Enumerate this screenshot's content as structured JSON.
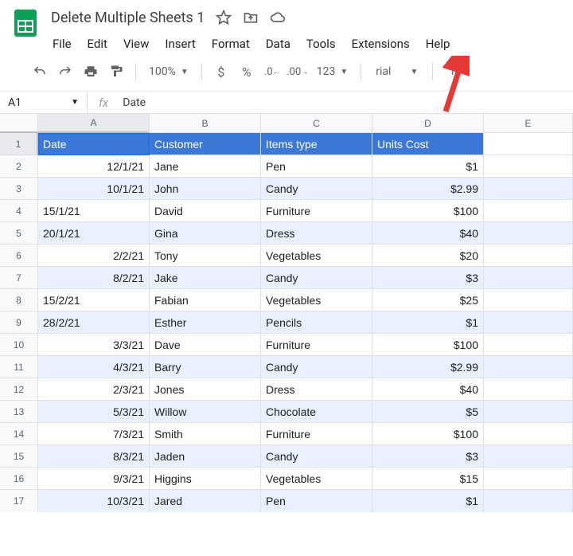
{
  "doc": {
    "title": "Delete Multiple Sheets 1"
  },
  "menus": [
    "File",
    "Edit",
    "View",
    "Insert",
    "Format",
    "Data",
    "Tools",
    "Extensions",
    "Help"
  ],
  "toolbar": {
    "zoom": "100%",
    "fmt": "123",
    "font": "rial",
    "fontsize": "10"
  },
  "namebox": "A1",
  "formula": "Date",
  "cols": [
    "A",
    "B",
    "C",
    "D",
    "E"
  ],
  "headers": {
    "A": "Date",
    "B": "Customer",
    "C": "Items type",
    "D": "Units Cost"
  },
  "rows": [
    {
      "n": 2,
      "A": "12/1/21",
      "Ar": true,
      "B": "Jane",
      "C": "Pen",
      "D": "$1",
      "band": false
    },
    {
      "n": 3,
      "A": "10/1/21",
      "Ar": true,
      "B": "John",
      "C": "Candy",
      "D": "$2.99",
      "band": true
    },
    {
      "n": 4,
      "A": "15/1/21",
      "Ar": false,
      "B": "David",
      "C": "Furniture",
      "D": "$100",
      "band": false
    },
    {
      "n": 5,
      "A": "20/1/21",
      "Ar": false,
      "B": "Gina",
      "C": "Dress",
      "D": "$40",
      "band": true
    },
    {
      "n": 6,
      "A": "2/2/21",
      "Ar": true,
      "B": "Tony",
      "C": "Vegetables",
      "D": "$20",
      "band": false
    },
    {
      "n": 7,
      "A": "8/2/21",
      "Ar": true,
      "B": "Jake",
      "C": "Candy",
      "D": "$3",
      "band": true
    },
    {
      "n": 8,
      "A": "15/2/21",
      "Ar": false,
      "B": "Fabian",
      "C": "Vegetables",
      "D": "$25",
      "band": false
    },
    {
      "n": 9,
      "A": "28/2/21",
      "Ar": false,
      "B": "Esther",
      "C": "Pencils",
      "D": "$1",
      "band": true
    },
    {
      "n": 10,
      "A": "3/3/21",
      "Ar": true,
      "B": "Dave",
      "C": "Furniture",
      "D": "$100",
      "band": false
    },
    {
      "n": 11,
      "A": "4/3/21",
      "Ar": true,
      "B": "Barry",
      "C": "Candy",
      "D": "$2.99",
      "band": true
    },
    {
      "n": 12,
      "A": "2/3/21",
      "Ar": true,
      "B": "Jones",
      "C": "Dress",
      "D": "$40",
      "band": false
    },
    {
      "n": 13,
      "A": "5/3/21",
      "Ar": true,
      "B": "Willow",
      "C": "Chocolate",
      "D": "$5",
      "band": true
    },
    {
      "n": 14,
      "A": "7/3/21",
      "Ar": true,
      "B": "Smith",
      "C": "Furniture",
      "D": "$100",
      "band": false
    },
    {
      "n": 15,
      "A": "8/3/21",
      "Ar": true,
      "B": "Jaden",
      "C": "Candy",
      "D": "$3",
      "band": true
    },
    {
      "n": 16,
      "A": "9/3/21",
      "Ar": true,
      "B": "Higgins",
      "C": "Vegetables",
      "D": "$15",
      "band": false
    },
    {
      "n": 17,
      "A": "10/3/21",
      "Ar": true,
      "B": "Jared",
      "C": "Pen",
      "D": "$1",
      "band": true
    }
  ]
}
